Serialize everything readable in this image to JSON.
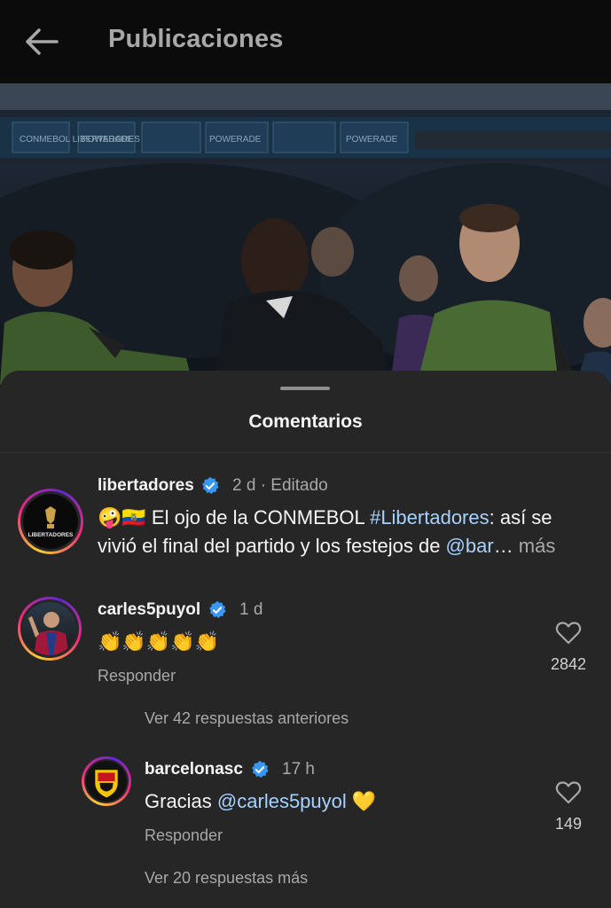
{
  "header": {
    "title": "Publicaciones"
  },
  "post": {
    "banner_text": [
      "CONMEBOL LIBERTADORES",
      "POWERADE",
      "CONMEBOL LIBERTADORES",
      "POWERADE",
      "CONMEBOL LIBERTADORES",
      "POWERADE"
    ]
  },
  "sheet": {
    "title": "Comentarios"
  },
  "caption": {
    "username": "libertadores",
    "time": "2 d · Editado",
    "avatar_text": "LIBERTADORES",
    "emojis": "🤪🇪🇨",
    "text_1": " El ojo de la CONMEBOL ",
    "hashtag": "#Libertadores",
    "text_2": ": así se",
    "text_3": "vivió el final del partido y los festejos de ",
    "mention": "@bar",
    "ellipsis": "…",
    "more": " más"
  },
  "comments": [
    {
      "username": "carles5puyol",
      "time": "1 d",
      "text": "👏👏👏👏👏",
      "reply_label": "Responder",
      "likes": "2842"
    }
  ],
  "view_previous_replies": "Ver 42 respuestas anteriores",
  "reply": {
    "username": "barcelonasc",
    "time": "17 h",
    "text_prefix": "Gracias ",
    "mention": "@carles5puyol",
    "emoji": " 💛",
    "reply_label": "Responder",
    "likes": "149"
  },
  "view_more_replies": "Ver 20 respuestas más",
  "colors": {
    "link": "#a7d1ff",
    "verified": "#3897f0",
    "sheet_bg": "#262626",
    "header_bg": "#0b0b0b"
  }
}
